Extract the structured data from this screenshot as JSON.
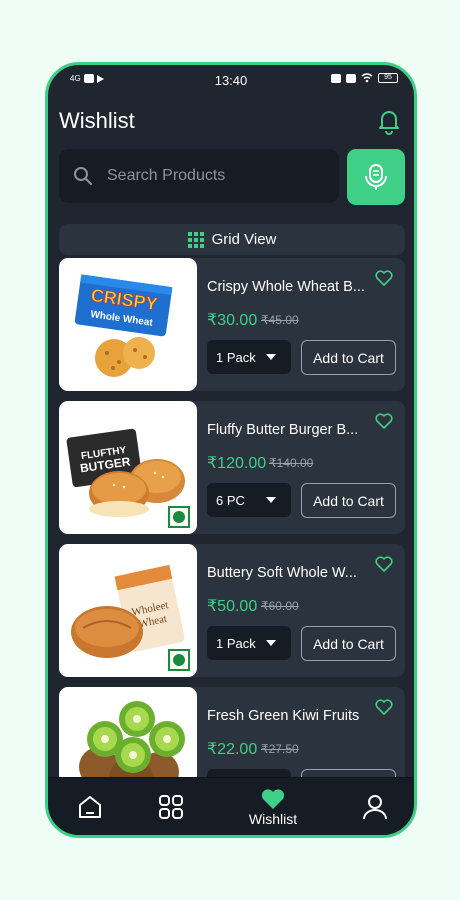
{
  "status_bar": {
    "time": "13:40",
    "network": "4G",
    "battery": "95"
  },
  "header": {
    "title": "Wishlist",
    "icon": "bell-icon"
  },
  "search": {
    "placeholder": "Search Products",
    "icon": "search-icon",
    "voice_icon": "microphone-icon"
  },
  "view_toggle": {
    "label": "Grid View",
    "icon": "grid-icon"
  },
  "products": [
    {
      "name": "Crispy Whole Wheat B...",
      "price": "₹30.00",
      "mrp": "₹45.00",
      "variant": "1 Pack",
      "cta": "Add to Cart",
      "veg": false
    },
    {
      "name": "Fluffy Butter Burger B...",
      "price": "₹120.00",
      "mrp": "₹140.00",
      "variant": "6 PC",
      "cta": "Add to Cart",
      "veg": true
    },
    {
      "name": "Buttery Soft Whole W...",
      "price": "₹50.00",
      "mrp": "₹60.00",
      "variant": "1 Pack",
      "cta": "Add to Cart",
      "veg": true
    },
    {
      "name": "Fresh Green Kiwi Fruits",
      "price": "₹22.00",
      "mrp": "₹27.50",
      "variant": "",
      "cta": "",
      "veg": false
    }
  ],
  "product_images": {
    "p1_brand": "CRISPY",
    "p1_sub": "Whole Wheat",
    "p2_brand": "FLUFTHY",
    "p2_sub": "BUTGER",
    "p3_brand": "Wholeet",
    "p3_sub": "Wheat"
  },
  "bottom_nav": {
    "active_label": "Wishlist",
    "items": [
      "home-icon",
      "categories-icon",
      "heart-icon",
      "profile-icon"
    ]
  },
  "colors": {
    "accent": "#3fcf87",
    "background": "#1f262f",
    "card": "#2b333e"
  }
}
